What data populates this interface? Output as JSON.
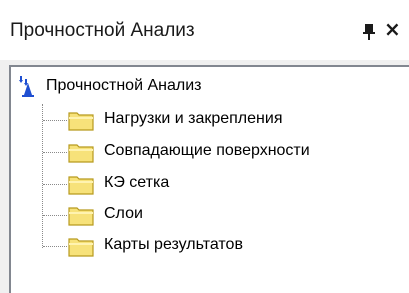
{
  "panel": {
    "title": "Прочностной Анализ",
    "pin_icon": "pin-icon",
    "close_glyph": "×"
  },
  "tree": {
    "root": {
      "label": "Прочностной Анализ",
      "icon": "analysis-root-icon"
    },
    "children": [
      {
        "label": "Нагрузки и закрепления",
        "icon": "folder-icon"
      },
      {
        "label": "Совпадающие поверхности",
        "icon": "folder-icon"
      },
      {
        "label": "КЭ сетка",
        "icon": "folder-icon"
      },
      {
        "label": "Слои",
        "icon": "folder-icon"
      },
      {
        "label": "Карты результатов",
        "icon": "folder-icon"
      }
    ]
  },
  "colors": {
    "folder_fill": "#f7e27a",
    "folder_stroke": "#b79a1e",
    "root_blue": "#1f4fd1"
  }
}
